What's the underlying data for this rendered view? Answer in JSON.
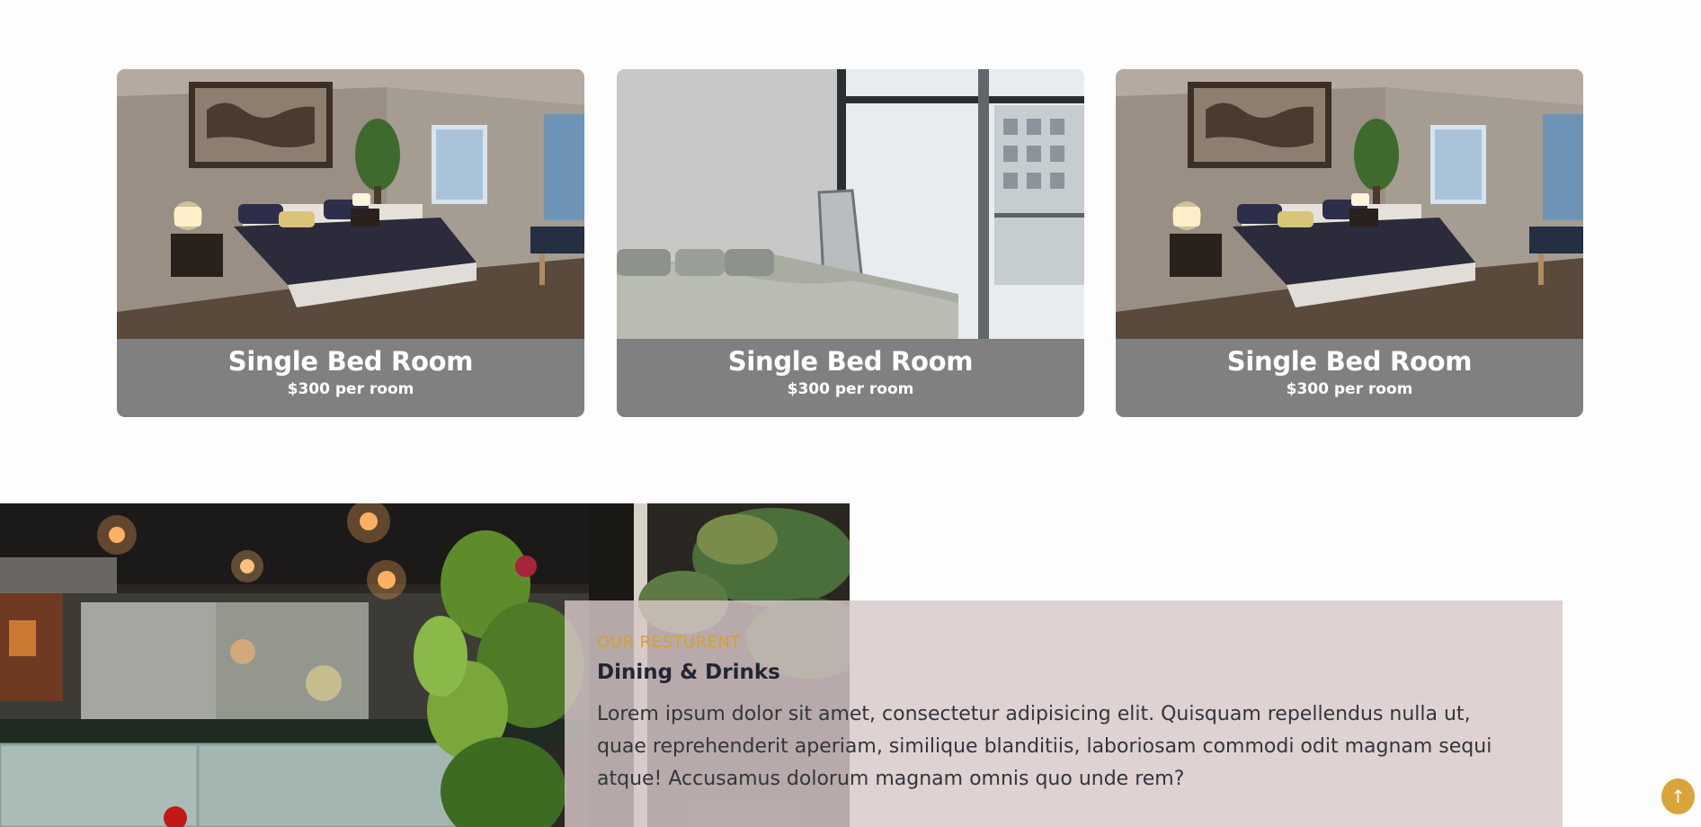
{
  "rooms": [
    {
      "title": "Single Bed Room",
      "price": "$300 per room"
    },
    {
      "title": "Single Bed Room",
      "price": "$300 per room"
    },
    {
      "title": "Single Bed Room",
      "price": "$300 per room"
    }
  ],
  "restaurant": {
    "kicker": "OUR RESTURENT",
    "heading": "Dining & Drinks",
    "description": "Lorem ipsum dolor sit amet, consectetur adipisicing elit. Quisquam repellendus nulla ut, quae reprehenderit aperiam, similique blanditiis, laboriosam commodi odit magnam sequi atque! Accusamus dolorum magnam omnis quo unde rem?"
  },
  "back_to_top": {
    "icon": "arrow-up-icon",
    "glyph": "↑"
  },
  "colors": {
    "accent": "#d4a12a",
    "card_caption_bg": "#808080",
    "panel_bg": "#d8c8c9",
    "button_bg": "#d9a43a"
  }
}
